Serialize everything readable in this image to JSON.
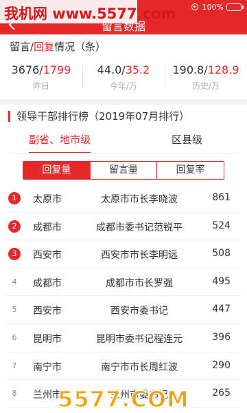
{
  "status_bar": {
    "watermark": "我机网 www.5577.com",
    "battery_percent": "100%"
  },
  "nav": {
    "title": "留言数据"
  },
  "summary": {
    "title_prefix": "留言/",
    "title_highlight": "回复",
    "title_suffix": "情况（条）",
    "stats": [
      {
        "value": "3676/",
        "value_highlight": "1799",
        "label": "昨日"
      },
      {
        "value": "44.0/",
        "value_highlight": "35.2",
        "label": "今年/万"
      },
      {
        "value": "190.8/",
        "value_highlight": "128.9",
        "label": "历史/万"
      }
    ]
  },
  "ranking": {
    "title": "领导干部排行榜（2019年07月排行）",
    "level_tabs": [
      "副省、地市级",
      "区县级"
    ],
    "metric_tabs": [
      "回复量",
      "留言量",
      "回复率"
    ],
    "rows": [
      {
        "rank": "1",
        "city": "太原市",
        "person": "太原市市长李晓波",
        "count": "861"
      },
      {
        "rank": "2",
        "city": "成都市",
        "person": "成都市委书记范锐平",
        "count": "524"
      },
      {
        "rank": "3",
        "city": "西安市",
        "person": "西安市市长李明远",
        "count": "508"
      },
      {
        "rank": "4",
        "city": "成都市",
        "person": "成都市市长罗强",
        "count": "495"
      },
      {
        "rank": "5",
        "city": "西安市",
        "person": "西安市委书记",
        "count": "447"
      },
      {
        "rank": "6",
        "city": "昆明市",
        "person": "昆明市委书记程连元",
        "count": "396"
      },
      {
        "rank": "7",
        "city": "南宁市",
        "person": "南宁市市长周红波",
        "count": "290"
      },
      {
        "rank": "8",
        "city": "兰州市",
        "person": "兰州市委书记",
        "count": "265"
      }
    ]
  },
  "footer_watermark": "5577.COM",
  "colors": {
    "accent": "#e5292b",
    "watermark": "#f4a000"
  }
}
